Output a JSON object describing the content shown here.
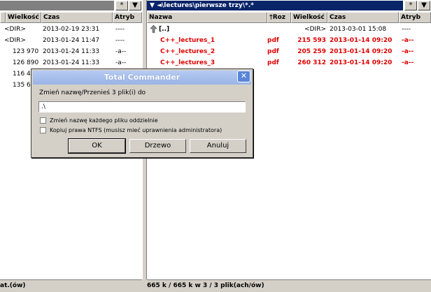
{
  "left_panel": {
    "path": "",
    "columns": [
      "Wielkość",
      "Czas",
      "Atryb"
    ],
    "rows": [
      {
        "size": "<DIR>",
        "date": "2013-02-19 23:31",
        "attr": "----"
      },
      {
        "size": "<DIR>",
        "date": "2013-01-24 11:47",
        "attr": "----"
      },
      {
        "size": "123 970",
        "date": "2013-01-24 11:33",
        "attr": "-a--"
      },
      {
        "size": "126 890",
        "date": "2013-01-24 11:33",
        "attr": "-a--"
      },
      {
        "size": "116 4",
        "date": "",
        "attr": ""
      },
      {
        "size": "135 6",
        "date": "",
        "attr": ""
      }
    ],
    "status": "at.(ów)"
  },
  "right_panel": {
    "path": "\\lectures\\pierwsze trzy\\*.*",
    "columns": [
      "Nazwa",
      "Roz",
      "Wielkość",
      "Czas",
      "Atryb"
    ],
    "rows": [
      {
        "name": "[..]",
        "ext": "",
        "size": "<DIR>",
        "date": "2013-03-01 15:08",
        "attr": "----",
        "selected": false
      },
      {
        "name": "C++_lectures_1",
        "ext": "pdf",
        "size": "215 593",
        "date": "2013-01-14 09:20",
        "attr": "-a--",
        "selected": true
      },
      {
        "name": "C++_lectures_2",
        "ext": "pdf",
        "size": "205 259",
        "date": "2013-01-14 09:20",
        "attr": "-a--",
        "selected": true
      },
      {
        "name": "C++_lectures_3",
        "ext": "pdf",
        "size": "260 312",
        "date": "2013-01-14 09:20",
        "attr": "-a--",
        "selected": true
      }
    ],
    "status": "665 k / 665 k w 3 / 3 plik(ach/ów)"
  },
  "path_buttons": {
    "star": "*",
    "dropdown": "▼",
    "back": "◄"
  },
  "dialog": {
    "title": "Total Commander",
    "prompt": "Zmień nazwę/Przenieś 3 plik(i) do",
    "target": ".\\",
    "option_rename_each": "Zmień nazwę każdego pliku oddzielnie",
    "option_copy_ntfs": "Kopiuj prawa NTFS (musisz mieć uprawnienia administratora)",
    "ok": "OK",
    "tree": "Drzewo",
    "cancel": "Anuluj",
    "close": "✕"
  },
  "colors": {
    "selected_text": "#e00000",
    "active_path": "#0a246a",
    "inactive_path": "#808080"
  }
}
